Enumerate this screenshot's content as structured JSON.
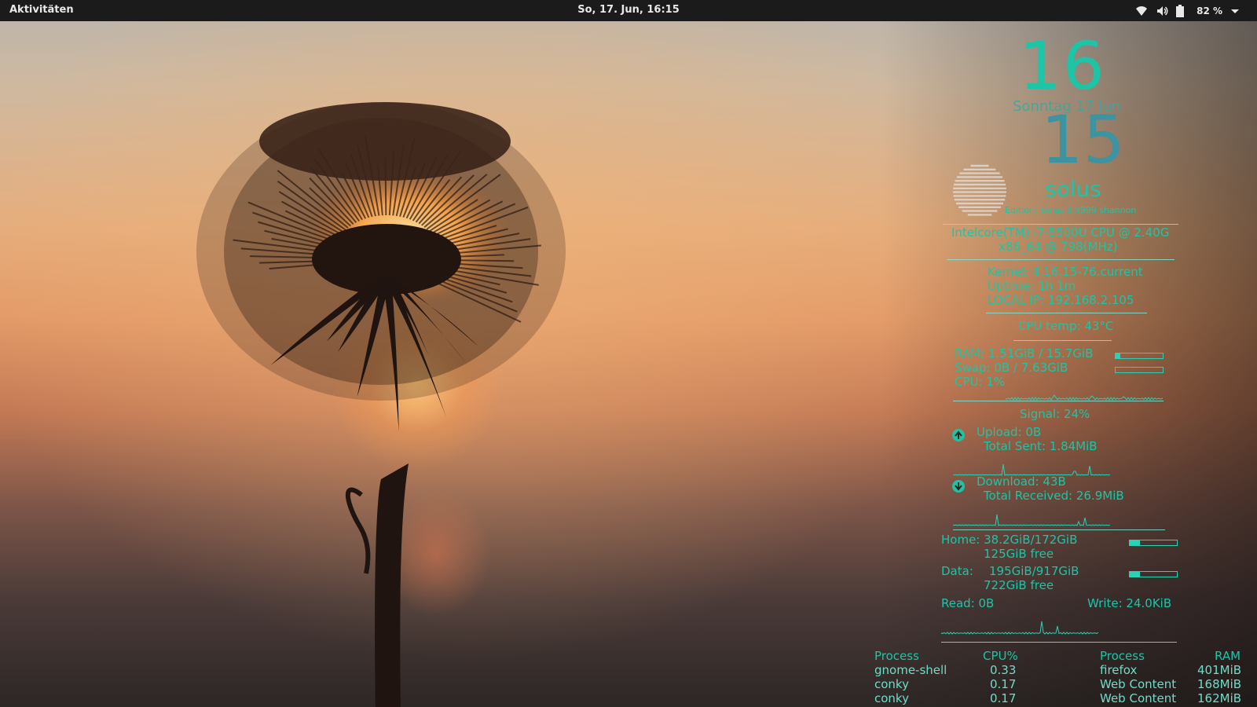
{
  "topbar": {
    "activities": "Aktivitäten",
    "clock": "So, 17. Jun, 16:15",
    "battery": "82 %",
    "icons": [
      "wifi-icon",
      "volume-icon",
      "battery-icon",
      "dropdown-arrow-icon"
    ]
  },
  "conky": {
    "hour": "16",
    "date": "Sonntag 17 Jun",
    "minute": "15",
    "os": "solus",
    "edition": "Edition: Solus 3.9999 shannon",
    "cpu_model": "Intelcore(TM) i7-5500U CPU @ 2.40G",
    "cpu_arch": "x86_64 @ 798(MHz)",
    "kernel": "Kernel: 4.16.15-76.current",
    "uptime": "Uptime: 1h 1m",
    "local_ip": "LOCAL IP: 192.168.2.105",
    "cpu_temp": "CPU temp: 43°C",
    "ram": "RAM: 1.51GiB / 15.7GiB",
    "ram_fraction": 0.1,
    "swap": "Swap: 0B  / 7.63GiB",
    "swap_fraction": 0.0,
    "cpu": "CPU: 1%",
    "signal": "Signal: 24%",
    "upload": "Upload: 0B",
    "total_sent": "Total Sent: 1.84MiB",
    "download": "Download: 43B",
    "total_received": "Total Received: 26.9MiB",
    "home": "Home: 38.2GiB/172GiB",
    "home_free": "125GiB free",
    "home_fraction": 0.22,
    "data_label": "Data:",
    "data_used": "195GiB/917GiB",
    "data_free": "722GiB free",
    "data_fraction": 0.21,
    "read": "Read: 0B",
    "write": "Write: 24.0KiB",
    "proc_cpu_header": [
      "Process",
      "CPU%"
    ],
    "proc_cpu": [
      [
        "gnome-shell",
        "0.33"
      ],
      [
        "conky",
        "0.17"
      ],
      [
        "conky",
        "0.17"
      ]
    ],
    "proc_ram_header": [
      "Process",
      "RAM"
    ],
    "proc_ram": [
      [
        "firefox",
        "401MiB"
      ],
      [
        "Web Content",
        "168MiB"
      ],
      [
        "Web Content",
        "162MiB"
      ]
    ]
  },
  "colors": {
    "accent": "#1fc3a3",
    "topbar": "#1b1b1b"
  }
}
